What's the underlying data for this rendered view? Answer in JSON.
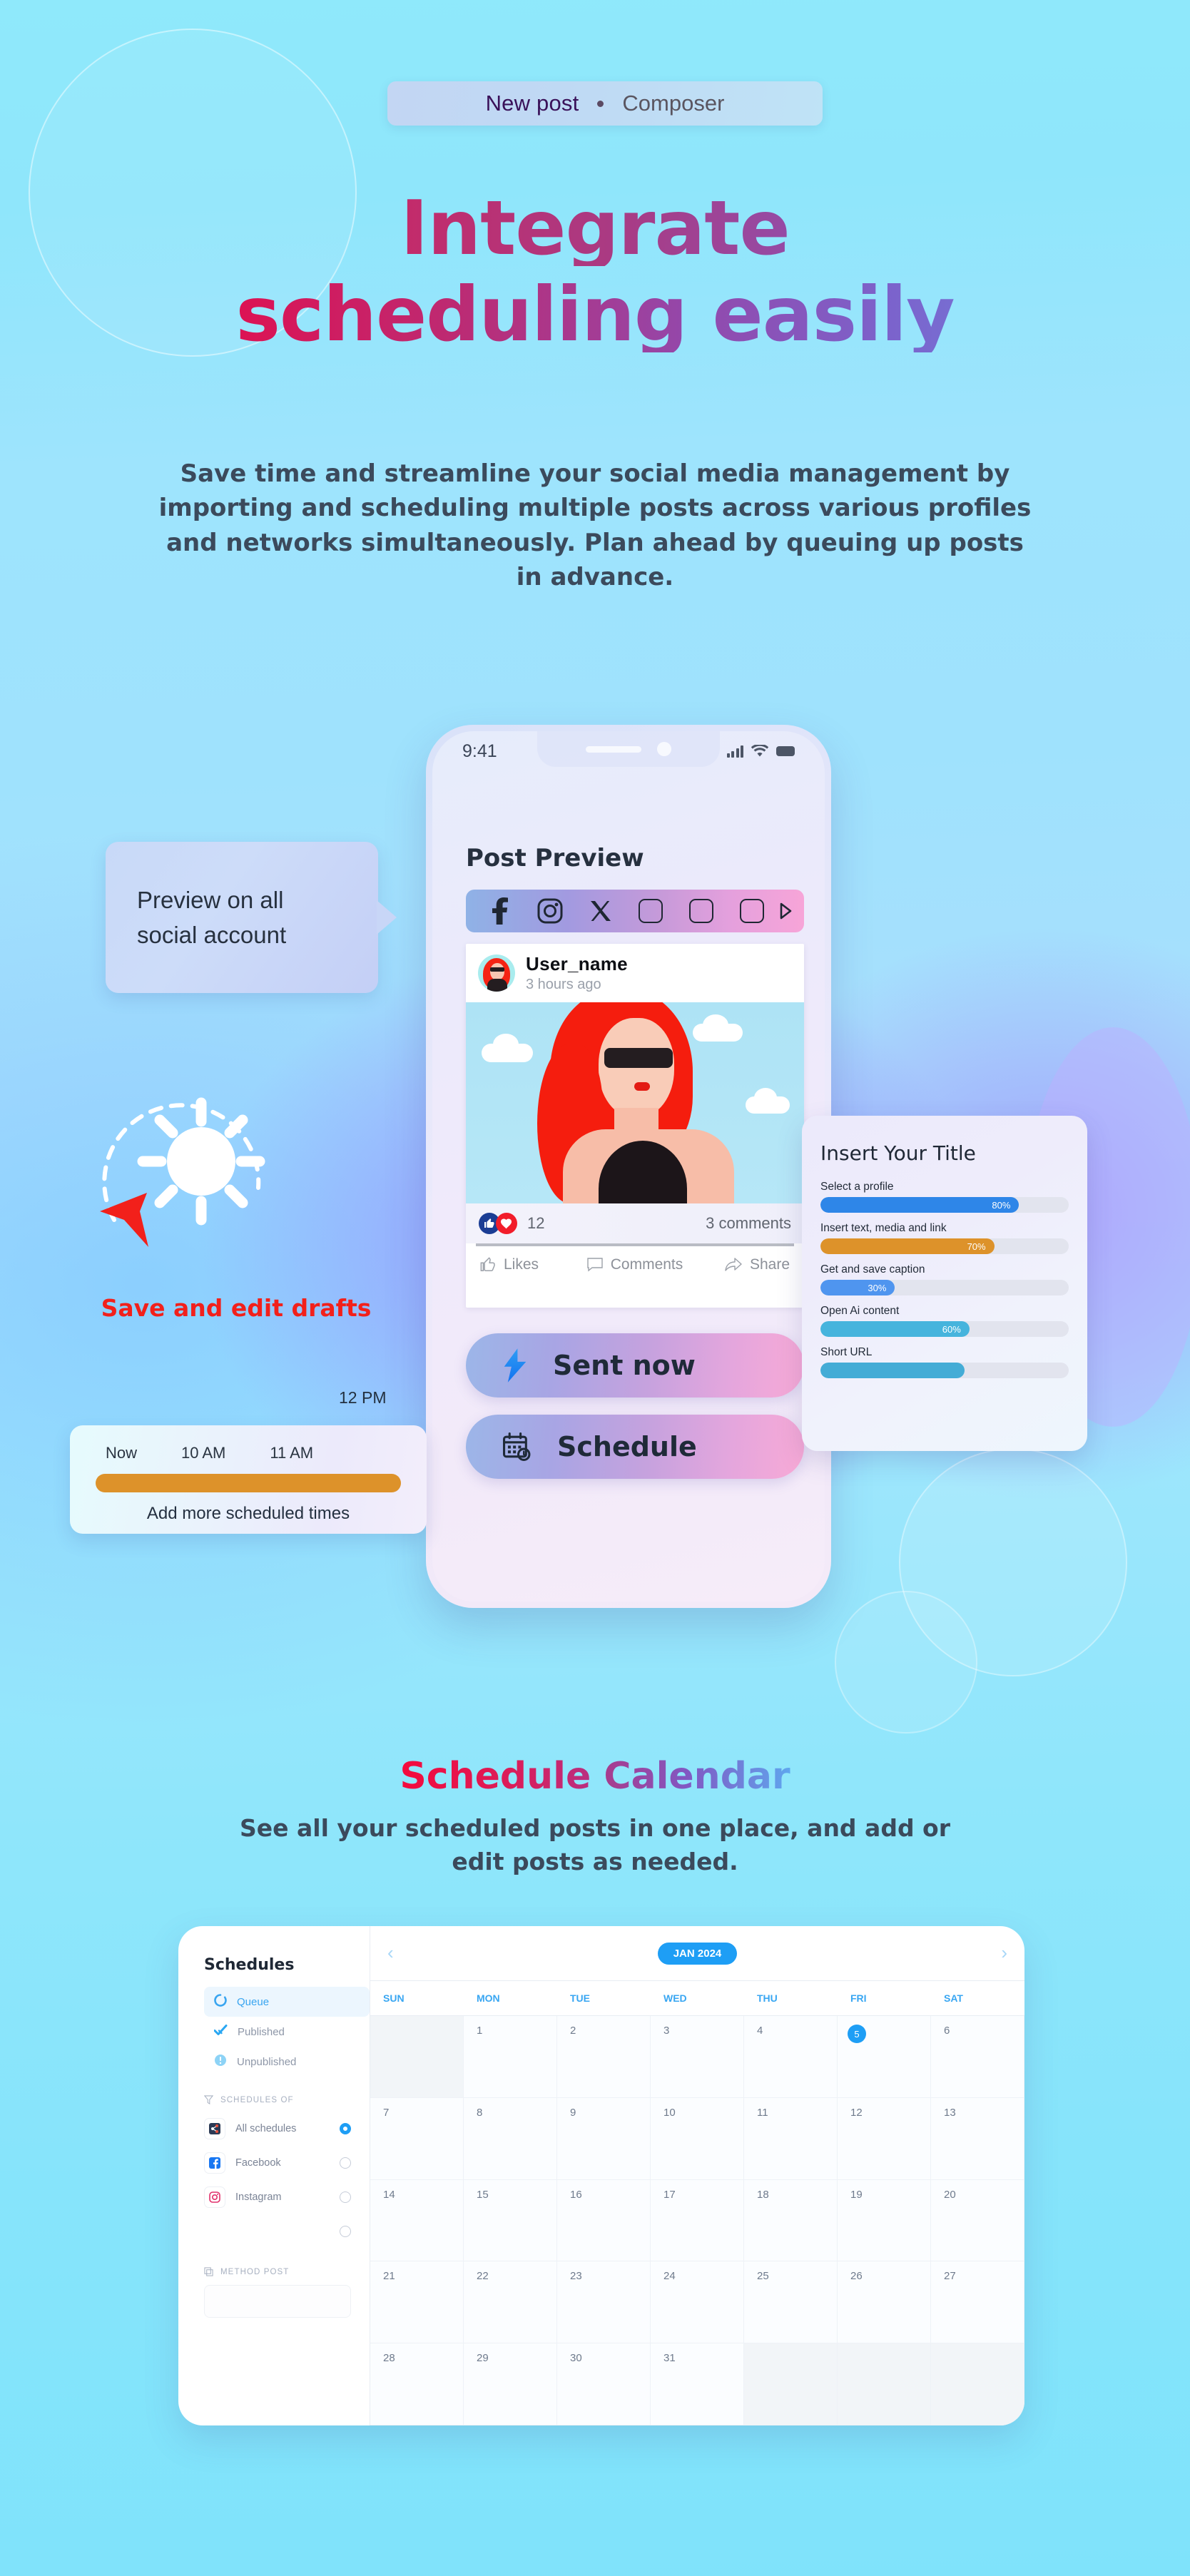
{
  "badge": {
    "primary": "New post",
    "separator": "•",
    "secondary": "Composer"
  },
  "hero": {
    "title_line1": "Integrate",
    "title_line2": "scheduling easily",
    "paragraph": "Save time and streamline your social media management by importing and scheduling multiple posts across various profiles and networks simultaneously. Plan ahead by queuing up posts in advance."
  },
  "phone": {
    "status_time": "9:41",
    "screen_title": "Post Preview",
    "social_tabs": [
      "facebook-icon",
      "instagram-icon",
      "x-icon",
      "blank-square-1",
      "blank-square-2",
      "blank-square-3",
      "next-arrow-icon"
    ],
    "post": {
      "user_name": "User_name",
      "timestamp": "3 hours ago",
      "reaction_count": "12",
      "comments_count": "3 comments",
      "actions": [
        "Likes",
        "Comments",
        "Share"
      ]
    },
    "cta": {
      "send_label": "Sent now",
      "schedule_label": "Schedule"
    }
  },
  "callout": {
    "text": "Preview on all social account"
  },
  "drafts": {
    "label": "Save and edit drafts"
  },
  "timeline": {
    "end_time": "12 PM",
    "times": [
      "Now",
      "10 AM",
      "11 AM"
    ],
    "add_label": "Add more scheduled times",
    "bar_color": "#dd922a"
  },
  "insert_panel": {
    "title": "Insert Your Title",
    "rows": [
      {
        "label": "Select a profile",
        "value": "80%",
        "pct": 80,
        "color": "#2e86e8"
      },
      {
        "label": "Insert text, media and link",
        "value": "70%",
        "pct": 70,
        "color": "#dd922a"
      },
      {
        "label": "Get and save caption",
        "value": "30%",
        "pct": 30,
        "color": "#4f95ef"
      },
      {
        "label": "Open Ai content",
        "value": "60%",
        "pct": 60,
        "color": "#46b4dd"
      },
      {
        "label": "Short URL",
        "value": "",
        "pct": 58,
        "color": "#44acd6"
      }
    ]
  },
  "schedule_section": {
    "title_part1": "Schedule ",
    "title_part2": "Calendar",
    "subtitle": "See all your scheduled posts in one place, and add or edit posts as needed."
  },
  "calendar": {
    "sidebar": {
      "title": "Schedules",
      "status_items": [
        {
          "label": "Queue",
          "icon": "queue-spinner-icon",
          "active": true
        },
        {
          "label": "Published",
          "icon": "check-icon",
          "active": false
        },
        {
          "label": "Unpublished",
          "icon": "exclamation-icon",
          "active": false
        }
      ],
      "filter_heading": "SCHEDULES OF",
      "filter_items": [
        {
          "label": "All schedules",
          "icon": "share-nodes-icon",
          "selected": true
        },
        {
          "label": "Facebook",
          "icon": "facebook-icon",
          "selected": false
        },
        {
          "label": "Instagram",
          "icon": "instagram-icon",
          "selected": false
        },
        {
          "label": "",
          "icon": "",
          "selected": false
        }
      ],
      "method_heading": "METHOD POST"
    },
    "month_label": "JAN 2024",
    "prev_icon": "chevron-left-icon",
    "next_icon": "chevron-right-icon",
    "day_headers": [
      "SUN",
      "MON",
      "TUE",
      "WED",
      "THU",
      "FRI",
      "SAT"
    ],
    "leading_blanks": 1,
    "days_in_month": 31,
    "today": 5
  },
  "colors": {
    "accent_blue": "#1e9ef5",
    "accent_pink": "#f50a3c",
    "orange": "#dd922a",
    "drafts_red": "#f2201b"
  }
}
